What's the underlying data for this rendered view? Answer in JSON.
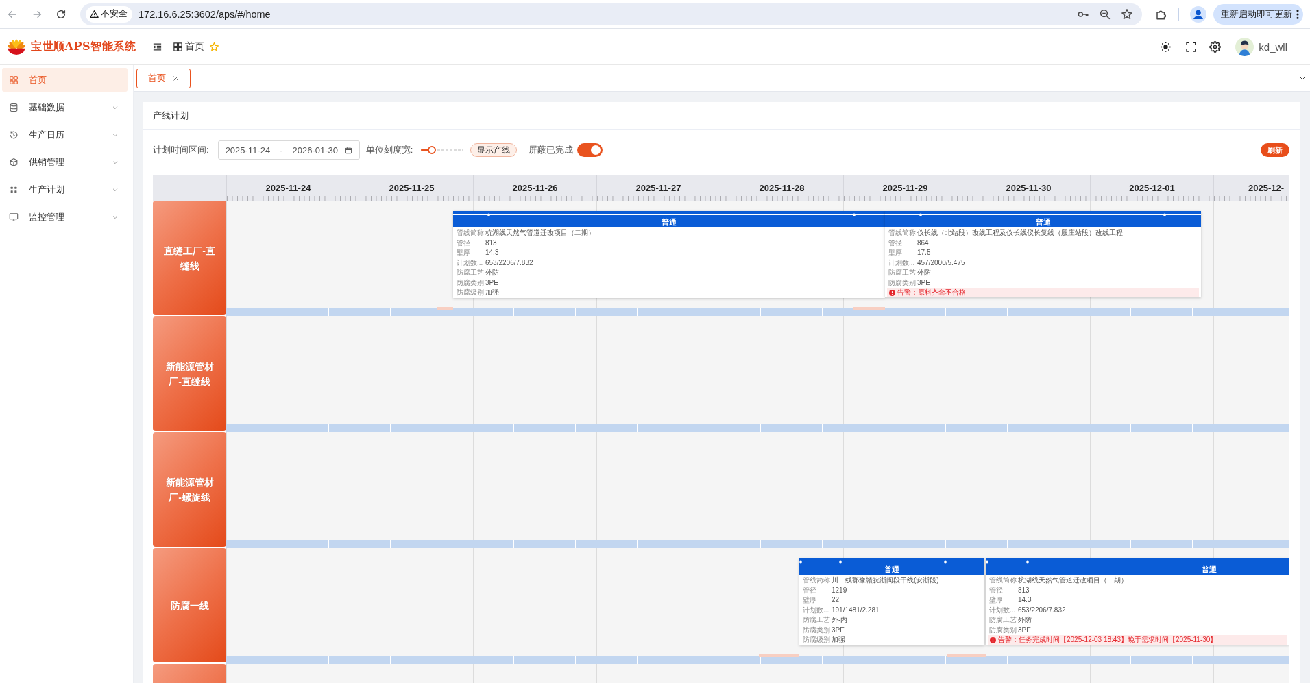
{
  "browser": {
    "security_label": "不安全",
    "url": "172.16.6.25:3602/aps/#/home",
    "update_button": "重新启动即可更新"
  },
  "header": {
    "title": "宝世顺APS智能系统",
    "breadcrumb": "首页",
    "user": "kd_wll"
  },
  "sidebar": {
    "items": [
      {
        "label": "首页",
        "kind": "page",
        "selected": true
      },
      {
        "label": "基础数据",
        "kind": "submenu",
        "selected": false,
        "expanded": false
      },
      {
        "label": "生产日历",
        "kind": "submenu",
        "selected": false,
        "expanded": false
      },
      {
        "label": "供销管理",
        "kind": "submenu",
        "selected": false,
        "expanded": false
      },
      {
        "label": "生产计划",
        "kind": "submenu",
        "selected": false,
        "expanded": false
      },
      {
        "label": "监控管理",
        "kind": "submenu",
        "selected": false,
        "expanded": false
      }
    ]
  },
  "tabs": [
    {
      "label": "首页",
      "selected": true
    }
  ],
  "panel": {
    "title": "产线计划"
  },
  "toolbar": {
    "range_label": "计划时间区间:",
    "start_date": "2025-11-24",
    "range_separator": "-",
    "end_date": "2026-01-30",
    "scale_label": "单位刻度宽:",
    "scale_slider": {
      "level": 0.26
    },
    "show_lines_button": "显示产线",
    "hide_completed": {
      "label": "屏蔽已完成",
      "on": true
    },
    "refresh_button": "刷新"
  },
  "gantt": {
    "days": [
      "2025-11-24",
      "2025-11-25",
      "2025-11-26",
      "2025-11-27",
      "2025-11-28",
      "2025-11-29",
      "2025-11-30",
      "2025-12-01",
      "2025-12-"
    ],
    "lines": [
      {
        "name": "直缝工厂-直缝线",
        "tasks": [
          {
            "title": "普通",
            "fields": [
              {
                "label": "管线简称",
                "value": "杭湖线天然气管道迁改项目（二期）"
              },
              {
                "label": "管径",
                "value": "813"
              },
              {
                "label": "壁厚",
                "value": "14.3"
              },
              {
                "label": "计划数...",
                "value": "653/2206/7.832"
              },
              {
                "label": "防腐工艺",
                "value": "外防"
              },
              {
                "label": "防腐类别",
                "value": "3PE"
              },
              {
                "label": "防腐级别",
                "value": "加强"
              }
            ]
          },
          {
            "title": "普通",
            "fields": [
              {
                "label": "管线简称",
                "value": "仪长线（北站段）改线工程及仪长线仪长复线（殷庄站段）改线工程"
              },
              {
                "label": "管径",
                "value": "864"
              },
              {
                "label": "壁厚",
                "value": "17.5"
              },
              {
                "label": "计划数...",
                "value": "457/2000/5.475"
              },
              {
                "label": "防腐工艺",
                "value": "外防"
              },
              {
                "label": "防腐类别",
                "value": "3PE"
              }
            ],
            "alert": "告警：原料齐套不合格"
          }
        ]
      },
      {
        "name": "新能源管材厂-直缝线"
      },
      {
        "name": "新能源管材厂-螺旋线"
      },
      {
        "name": "防腐一线",
        "tasks": [
          {
            "title": "普通",
            "fields": [
              {
                "label": "管线简称",
                "value": "川二线鄂豫赣皖浙闽段干线(安浙段)"
              },
              {
                "label": "管径",
                "value": "1219"
              },
              {
                "label": "壁厚",
                "value": "22"
              },
              {
                "label": "计划数...",
                "value": "191/1481/2.281"
              },
              {
                "label": "防腐工艺",
                "value": "外-内"
              },
              {
                "label": "防腐类别",
                "value": "3PE"
              },
              {
                "label": "防腐级别",
                "value": "加强"
              }
            ]
          },
          {
            "title": "普通",
            "fields": [
              {
                "label": "管线简称",
                "value": "杭湖线天然气管道迁改项目（二期）"
              },
              {
                "label": "管径",
                "value": "813"
              },
              {
                "label": "壁厚",
                "value": "14.3"
              },
              {
                "label": "计划数...",
                "value": "653/2206/7.832"
              },
              {
                "label": "防腐工艺",
                "value": "外防"
              },
              {
                "label": "防腐类别",
                "value": "3PE"
              }
            ],
            "alert": "告警：任务完成时间【2025-12-03 18:43】晚于需求时间【2025-11-30】"
          }
        ]
      }
    ]
  }
}
